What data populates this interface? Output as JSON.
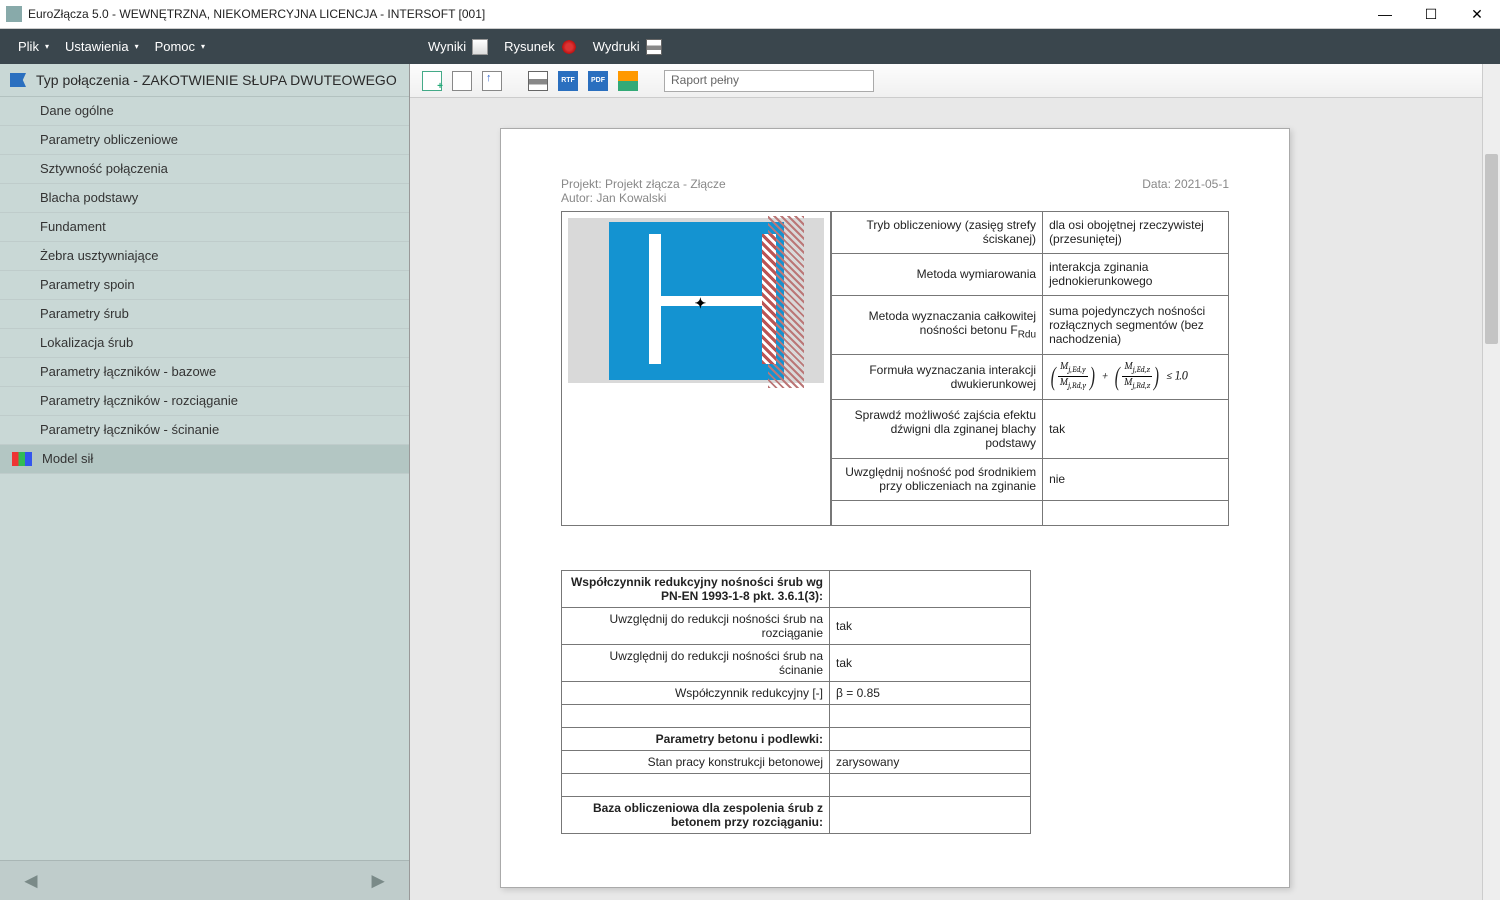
{
  "window": {
    "title": "EuroZłącza 5.0 - WEWNĘTRZNA, NIEKOMERCYJNA LICENCJA - INTERSOFT [001]"
  },
  "menubar": {
    "left": [
      {
        "label": "Plik",
        "caret": true
      },
      {
        "label": "Ustawienia",
        "caret": true
      },
      {
        "label": "Pomoc",
        "caret": true
      }
    ],
    "right": [
      {
        "label": "Wyniki",
        "icon": "chart-icon"
      },
      {
        "label": "Rysunek",
        "icon": "draw-icon"
      },
      {
        "label": "Wydruki",
        "icon": "print-icon"
      }
    ]
  },
  "toolbar": {
    "report_dropdown": "Raport pełny"
  },
  "sidebar": {
    "header": "Typ połączenia - ZAKOTWIENIE SŁUPA DWUTEOWEGO",
    "items": [
      "Dane ogólne",
      "Parametry obliczeniowe",
      "Sztywność połączenia",
      "Blacha podstawy",
      "Fundament",
      "Żebra usztywniające",
      "Parametry spoin",
      "Parametry śrub",
      "Lokalizacja śrub",
      "Parametry łączników - bazowe",
      "Parametry łączników - rozciąganie",
      "Parametry łączników - ścinanie"
    ],
    "selected": "Model sił"
  },
  "report": {
    "project_label": "Projekt:",
    "project": "Projekt złącza - Złącze",
    "author_label": "Autor:",
    "author": "Jan Kowalski",
    "date_label": "Data:",
    "date": "2021-05-1",
    "table1": [
      {
        "label": "Tryb obliczeniowy (zasięg strefy ściskanej)",
        "value": "dla osi obojętnej rzeczywistej (przesuniętej)"
      },
      {
        "label": "Metoda wymiarowania",
        "value": "interakcja zginania jednokierunkowego"
      },
      {
        "label": "Metoda wyznaczania całkowitej nośności betonu F",
        "label_sub": "Rdu",
        "value": "suma pojedynczych nośności rozłącznych segmentów (bez nachodzenia)"
      },
      {
        "label": "Formuła wyznaczania interakcji dwukierunkowej",
        "value_formula": true,
        "le": "≤ 1.0"
      },
      {
        "label": "Sprawdź możliwość zajścia efektu dźwigni dla zginanej blachy podstawy",
        "value": "tak"
      },
      {
        "label": "Uwzględnij nośność pod środnikiem przy obliczeniach na zginanie",
        "value": "nie"
      }
    ],
    "table2_header": "Współczynnik redukcyjny nośności śrub wg PN-EN 1993-1-8 pkt. 3.6.1(3):",
    "table2": [
      {
        "label": "Uwzględnij do redukcji nośności śrub na rozciąganie",
        "value": "tak"
      },
      {
        "label": "Uwzględnij do redukcji nośności śrub na ścinanie",
        "value": "tak"
      },
      {
        "label": "Współczynnik redukcyjny [-]",
        "value": "β = 0.85"
      }
    ],
    "table2b_header": "Parametry betonu i podlewki:",
    "table2b": [
      {
        "label": "Stan pracy konstrukcji betonowej",
        "value": "zarysowany"
      }
    ],
    "table2c_header": "Baza obliczeniowa dla zespolenia śrub z betonem przy rozciąganiu:"
  }
}
